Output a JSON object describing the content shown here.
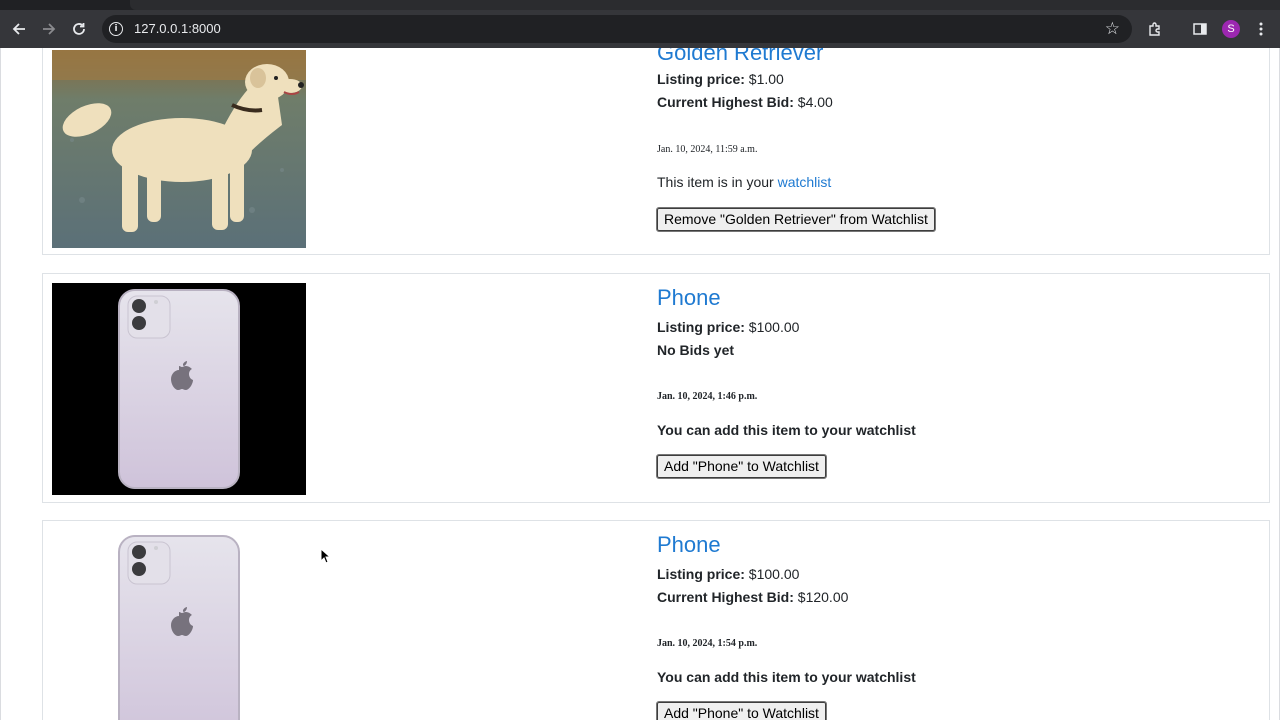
{
  "browser": {
    "url": "127.0.0.1:8000",
    "avatar_letter": "S",
    "icons": [
      "back-icon",
      "forward-icon",
      "reload-icon",
      "info-icon",
      "star-icon",
      "extensions-icon",
      "side-panel-icon",
      "menu-icon"
    ]
  },
  "listings": [
    {
      "title": "Golden Retriever",
      "listing_price_label": "Listing price:",
      "listing_price": "$1.00",
      "bid_label": "Current Highest Bid:",
      "bid_value": "$4.00",
      "date": "Jan. 10, 2024, 11:59 a.m.",
      "watchlist_text": "This item is in your",
      "watchlist_link": "watchlist",
      "button": "Remove \"Golden Retriever\" from Watchlist",
      "image": "golden-retriever-photo"
    },
    {
      "title": "Phone",
      "listing_price_label": "Listing price:",
      "listing_price": "$100.00",
      "bid_label": "No Bids yet",
      "bid_value": "",
      "date": "Jan. 10, 2024, 1:46 p.m.",
      "watchlist_text": "You can add this item to your watchlist",
      "button": "Add \"Phone\" to Watchlist",
      "image": "phone-photo-black-bg"
    },
    {
      "title": "Phone",
      "listing_price_label": "Listing price:",
      "listing_price": "$100.00",
      "bid_label": "Current Highest Bid:",
      "bid_value": "$120.00",
      "date": "Jan. 10, 2024, 1:54 p.m.",
      "watchlist_text": "You can add this item to your watchlist",
      "button": "Add \"Phone\" to Watchlist",
      "image": "phone-photo-white-bg"
    }
  ],
  "colors": {
    "link": "#1f7ad1",
    "chrome": "#35363a",
    "omnibox": "#202124",
    "avatar": "#9c27b0"
  }
}
